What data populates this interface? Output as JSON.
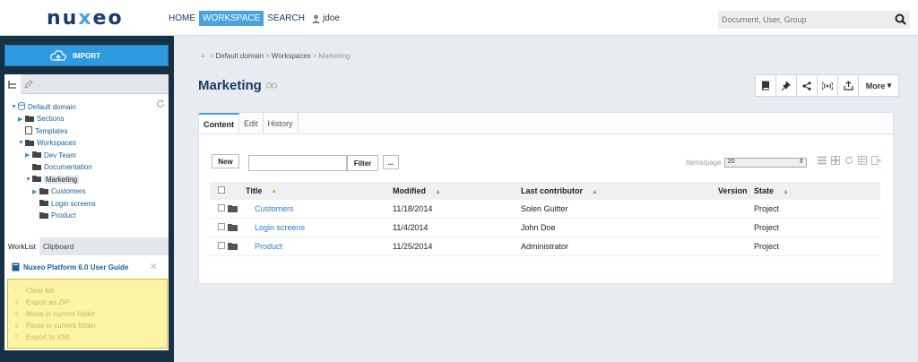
{
  "header": {
    "logo": "nuxeo",
    "nav": [
      "HOME",
      "WORKSPACE",
      "SEARCH"
    ],
    "user": "jdoe",
    "search_placeholder": "Document, User, Group"
  },
  "sidebar": {
    "import_label": "IMPORT",
    "tree": [
      {
        "label": "Default domain",
        "level": 0,
        "caret": "▼",
        "icon": "database-icon"
      },
      {
        "label": "Sections",
        "level": 1,
        "caret": "▶",
        "icon": "folder-icon"
      },
      {
        "label": "Templates",
        "level": 1,
        "caret": "",
        "icon": "document-icon"
      },
      {
        "label": "Workspaces",
        "level": 1,
        "caret": "▼",
        "icon": "folder-icon"
      },
      {
        "label": "Dev Team",
        "level": 2,
        "caret": "▶",
        "icon": "folder-icon"
      },
      {
        "label": "Documentation",
        "level": 2,
        "caret": "",
        "icon": "folder-icon"
      },
      {
        "label": "Marketing",
        "level": 2,
        "caret": "▼",
        "icon": "folder-icon",
        "selected": true
      },
      {
        "label": "Customers",
        "level": 3,
        "caret": "▶",
        "icon": "folder-icon"
      },
      {
        "label": "Login screens",
        "level": 3,
        "caret": "",
        "icon": "folder-icon"
      },
      {
        "label": "Product",
        "level": 3,
        "caret": "",
        "icon": "folder-icon"
      }
    ],
    "worklist_tabs": [
      "WorkList",
      "Clipboard"
    ],
    "worklist_item": "Nuxeo Platform 6.0 User Guide",
    "worklist_actions": [
      "Clear list",
      "Export as ZIP",
      "Move in current folder",
      "Paste in current folder",
      "Export to XML"
    ]
  },
  "breadcrumb": {
    "items": [
      "Default domain",
      "Workspaces"
    ],
    "current": "Marketing"
  },
  "page_title": "Marketing",
  "toolbar": {
    "more_label": "More"
  },
  "content": {
    "tabs": [
      "Content",
      "Edit",
      "History"
    ],
    "new_label": "New",
    "filter_label": "Filter",
    "more_label": "...",
    "items_per_page_label": "Items/page",
    "items_per_page_value": "20",
    "columns": [
      "Title",
      "Modified",
      "Last contributor",
      "Version",
      "State"
    ],
    "rows": [
      {
        "title": "Customers",
        "modified": "11/18/2014",
        "contributor": "Solen Guitter",
        "version": "",
        "state": "Project"
      },
      {
        "title": "Login screens",
        "modified": "11/4/2014",
        "contributor": "John Doe",
        "version": "",
        "state": "Project"
      },
      {
        "title": "Product",
        "modified": "11/25/2014",
        "contributor": "Administrator",
        "version": "",
        "state": "Project"
      }
    ]
  },
  "colors": {
    "accent": "#4aa3df",
    "navy": "#1a3a6e",
    "sidebar": "#173044",
    "worklist": "#fdf4a6"
  }
}
